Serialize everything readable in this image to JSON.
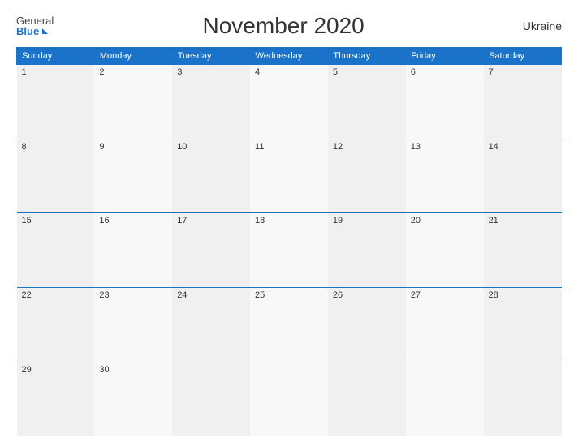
{
  "header": {
    "logo_general": "General",
    "logo_blue": "Blue",
    "title": "November 2020",
    "country": "Ukraine"
  },
  "days_of_week": [
    "Sunday",
    "Monday",
    "Tuesday",
    "Wednesday",
    "Thursday",
    "Friday",
    "Saturday"
  ],
  "weeks": [
    [
      1,
      2,
      3,
      4,
      5,
      6,
      7
    ],
    [
      8,
      9,
      10,
      11,
      12,
      13,
      14
    ],
    [
      15,
      16,
      17,
      18,
      19,
      20,
      21
    ],
    [
      22,
      23,
      24,
      25,
      26,
      27,
      28
    ],
    [
      29,
      30,
      null,
      null,
      null,
      null,
      null
    ]
  ]
}
